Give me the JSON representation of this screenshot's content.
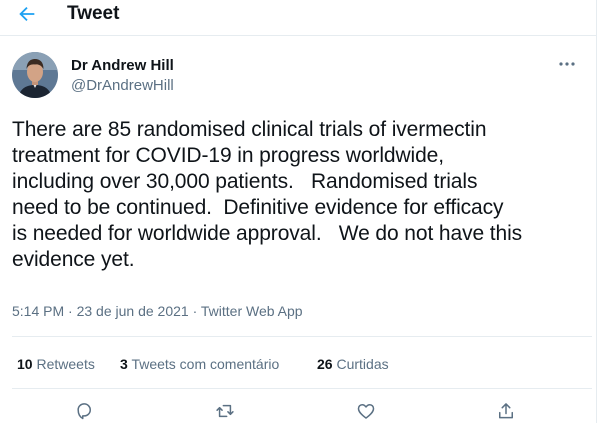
{
  "header": {
    "title": "Tweet"
  },
  "author": {
    "name": "Dr Andrew Hill",
    "handle": "@DrAndrewHill"
  },
  "tweet": {
    "text": "There are 85 randomised clinical trials of ivermectin\ntreatment for COVID-19 in progress worldwide,\nincluding over 30,000 patients.   Randomised trials\nneed to be continued.  Definitive evidence for efficacy\nis needed for worldwide approval.   We do not have this\nevidence yet."
  },
  "meta": {
    "time": "5:14 PM",
    "separator": "·",
    "date": "23 de jun de 2021",
    "source": "Twitter Web App"
  },
  "stats": {
    "retweets_count": "10",
    "retweets_label": "Retweets",
    "quotes_count": "3",
    "quotes_label": "Tweets com comentário",
    "likes_count": "26",
    "likes_label": "Curtidas"
  },
  "icons": {
    "back": "arrow-left-icon",
    "more": "more-dots-icon",
    "reply": "reply-icon",
    "retweet": "retweet-icon",
    "like": "heart-icon",
    "share": "share-icon"
  },
  "colors": {
    "accent": "#1da1f2",
    "text": "#0f1419",
    "secondary": "#5b7083",
    "divider": "#e6ecf0"
  }
}
